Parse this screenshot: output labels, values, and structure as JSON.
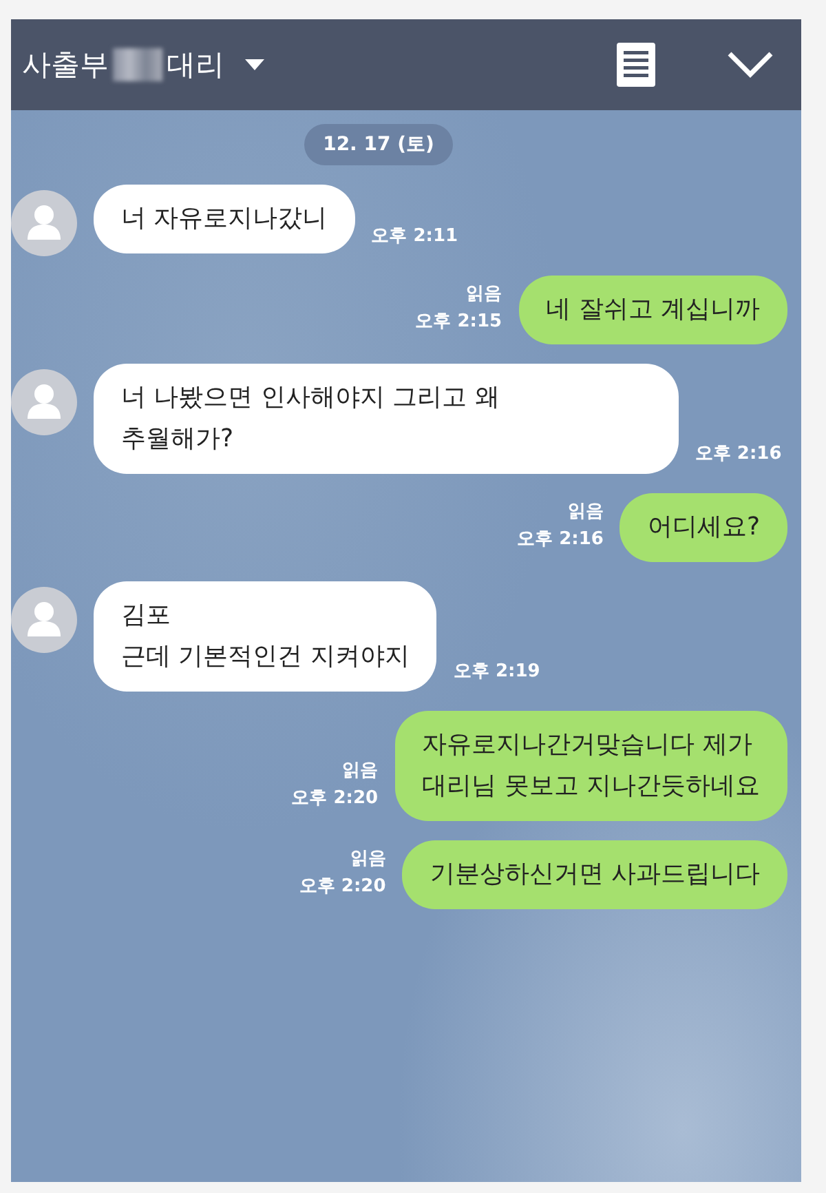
{
  "header": {
    "title_prefix": "사출부",
    "title_suffix": "대리"
  },
  "date": "12. 17 (토)",
  "messages": [
    {
      "kind": "received",
      "text": "너 자유로지나갔니",
      "time": "오후 2:11"
    },
    {
      "kind": "sent",
      "text": "네 잘쉬고 계십니까",
      "read": "읽음",
      "time": "오후 2:15"
    },
    {
      "kind": "received",
      "text": "너 나봤으면 인사해야지 그리고 왜\n추월해가?",
      "time": "오후 2:16"
    },
    {
      "kind": "sent",
      "text": "어디세요?",
      "read": "읽음",
      "time": "오후 2:16"
    },
    {
      "kind": "received",
      "text": "김포\n근데 기본적인건 지켜야지",
      "time": "오후 2:19"
    },
    {
      "kind": "sent",
      "text": "자유로지나간거맞습니다 제가\n대리님 못보고 지나간듯하네요",
      "read": "읽음",
      "time": "오후 2:20"
    },
    {
      "kind": "sent",
      "text": "기분상하신거면 사과드립니다",
      "read": "읽음",
      "time": "오후 2:20"
    }
  ]
}
